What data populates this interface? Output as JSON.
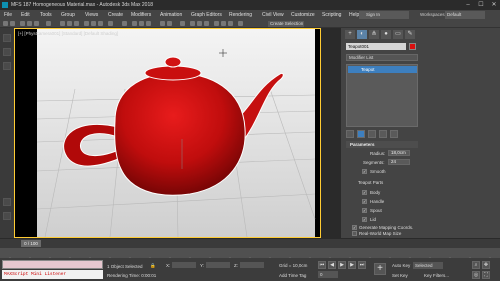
{
  "window": {
    "title": "MFS 187 Homogeneous Material.max - Autodesk 3ds Max 2018",
    "controls": [
      "–",
      "☐",
      "✕"
    ]
  },
  "menu": {
    "items": [
      "File",
      "Edit",
      "Tools",
      "Group",
      "Views",
      "Create",
      "Modifiers",
      "Animation",
      "Graph Editors",
      "Rendering",
      "Civil View",
      "Customize",
      "Scripting",
      "Help"
    ],
    "selection_set": "Create Selection Se",
    "signin": "Sign In",
    "workspaces_label": "Workspaces:",
    "workspace_value": "Default"
  },
  "viewport": {
    "label": "[+] [PhysCamera001] [Standard] [Default Shading]",
    "object_color": "#d90f0f",
    "background_top": "#f4f4f4",
    "background_bottom": "#cfcfcf",
    "border_color": "#ffcc33"
  },
  "command_panel": {
    "object_name": "Teapot001",
    "modifier_list": "Modifier List",
    "stack_item": "Teapot",
    "rollout_title": "Parameters",
    "radius_label": "Radius:",
    "radius_value": "18,0cm",
    "segments_label": "Segments:",
    "segments_value": "24",
    "smooth_label": "Smooth",
    "parts_label": "Teapot Parts",
    "parts": [
      "Body",
      "Handle",
      "Spout",
      "Lid"
    ],
    "mapping_label": "Generate Mapping Coords.",
    "realworld_label": "Real-World Map Size"
  },
  "timeline": {
    "frame_display": "0 / 100"
  },
  "status": {
    "maxscript_text": "MAXScript Mini Listener",
    "selected_text": "1 Object Selected",
    "render_time": "Rendering Time: 0:00:01",
    "x_label": "X:",
    "y_label": "Y:",
    "z_label": "Z:",
    "grid_text": "Grid = 10,0cm",
    "add_time_tag": "Add Time Tag",
    "autokey": "Auto Key",
    "autokey_value": "Selected",
    "setkey": "Set Key",
    "key_filters": "Key Filters...",
    "frame_value": "0"
  }
}
